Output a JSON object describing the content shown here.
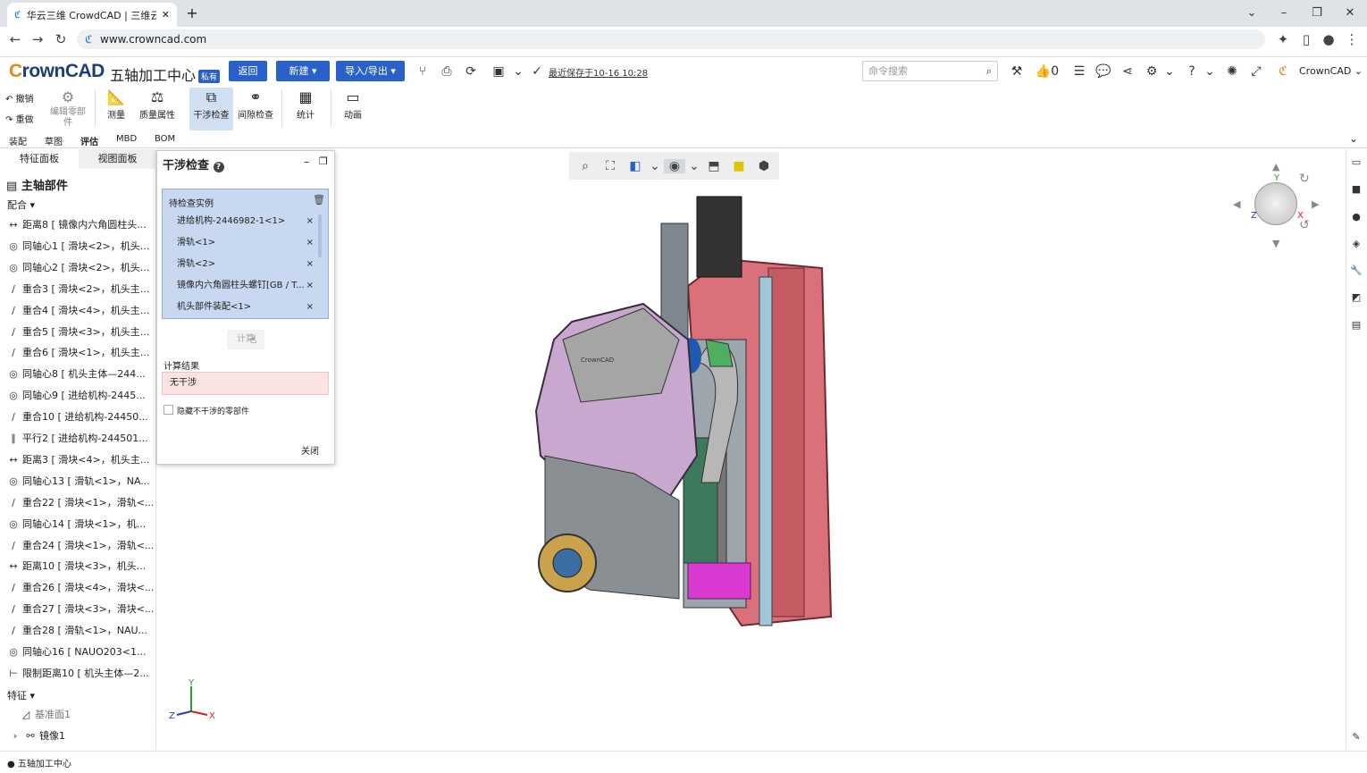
{
  "browser": {
    "tab_title": "华云三维 CrowdCAD | 三维云C/",
    "url": "www.crowncad.com"
  },
  "app": {
    "logo_c": "C",
    "logo_rest": "rownCAD",
    "doc_title": "五轴加工中心",
    "private_badge": "私有",
    "back_btn": "返回",
    "new_btn": "新建 ▾",
    "import_btn": "导入/导出 ▾",
    "save_status": "最近保存于10-16 10:28",
    "cmd_placeholder": "命令搜索",
    "like_count": "0",
    "user": "CrownCAD"
  },
  "ribbon": {
    "undo": "撤销",
    "redo": "重做",
    "edit_part": "编辑零部件",
    "measure": "测量",
    "mass": "质量属性",
    "interference": "干涉检查",
    "clearance": "间隙检查",
    "stats": "统计",
    "animation": "动画"
  },
  "subtabs": [
    "装配",
    "草图",
    "评估",
    "MBD",
    "BOM"
  ],
  "panel": {
    "tab1": "特征面板",
    "tab2": "视图面板",
    "root": "主轴部件",
    "mates_header": "配合 ▾",
    "features_header": "特征 ▾",
    "mates": [
      {
        "g": "↔",
        "t": "距离8 [ 镜像内六角圆柱头..."
      },
      {
        "g": "◎",
        "t": "同轴心1 [ 滑块<2>，机头..."
      },
      {
        "g": "◎",
        "t": "同轴心2 [ 滑块<2>，机头..."
      },
      {
        "g": "∕",
        "t": "重合3 [ 滑块<2>，机头主..."
      },
      {
        "g": "∕",
        "t": "重合4 [ 滑块<4>，机头主..."
      },
      {
        "g": "∕",
        "t": "重合5 [ 滑块<3>，机头主..."
      },
      {
        "g": "∕",
        "t": "重合6 [ 滑块<1>，机头主..."
      },
      {
        "g": "◎",
        "t": "同轴心8 [ 机头主体—244..."
      },
      {
        "g": "◎",
        "t": "同轴心9 [ 进给机构-2445..."
      },
      {
        "g": "∕",
        "t": "重合10 [ 进给机构-24450..."
      },
      {
        "g": "∥",
        "t": "平行2 [ 进给机构-244501..."
      },
      {
        "g": "↔",
        "t": "距离3 [ 滑块<4>，机头主..."
      },
      {
        "g": "◎",
        "t": "同轴心13 [ 滑轨<1>，NA..."
      },
      {
        "g": "∕",
        "t": "重合22 [ 滑块<1>，滑轨<..."
      },
      {
        "g": "◎",
        "t": "同轴心14 [ 滑块<1>，机..."
      },
      {
        "g": "∕",
        "t": "重合24 [ 滑块<1>，滑轨<..."
      },
      {
        "g": "↔",
        "t": "距离10 [ 滑块<3>，机头..."
      },
      {
        "g": "∕",
        "t": "重合26 [ 滑块<4>，滑块<..."
      },
      {
        "g": "∕",
        "t": "重合27 [ 滑块<3>，滑块<..."
      },
      {
        "g": "∕",
        "t": "重合28 [ 滑轨<1>，NAU..."
      },
      {
        "g": "◎",
        "t": "同轴心16 [ NAUO203<1..."
      },
      {
        "g": "⊢",
        "t": "限制距离10 [ 机头主体—2..."
      }
    ],
    "features": [
      {
        "t": "基准面1"
      },
      {
        "t": "镜像1"
      }
    ]
  },
  "dialog": {
    "title": "干涉检查",
    "list_header": "待检查实例",
    "instances": [
      "进给机构-2446982-1<1>",
      "滑轨<1>",
      "滑轨<2>",
      "镜像内六角圆柱头螺钉[GB / T...",
      "机头部件装配<1>"
    ],
    "calc_btn": "计算",
    "result_label": "计算结果",
    "result_value": "无干涉",
    "hide_label": "隐藏不干涉的零部件",
    "close_btn": "关闭"
  },
  "status": {
    "doc": "五轴加工中心"
  },
  "axis": {
    "x": "X",
    "y": "Y",
    "z": "Z"
  }
}
